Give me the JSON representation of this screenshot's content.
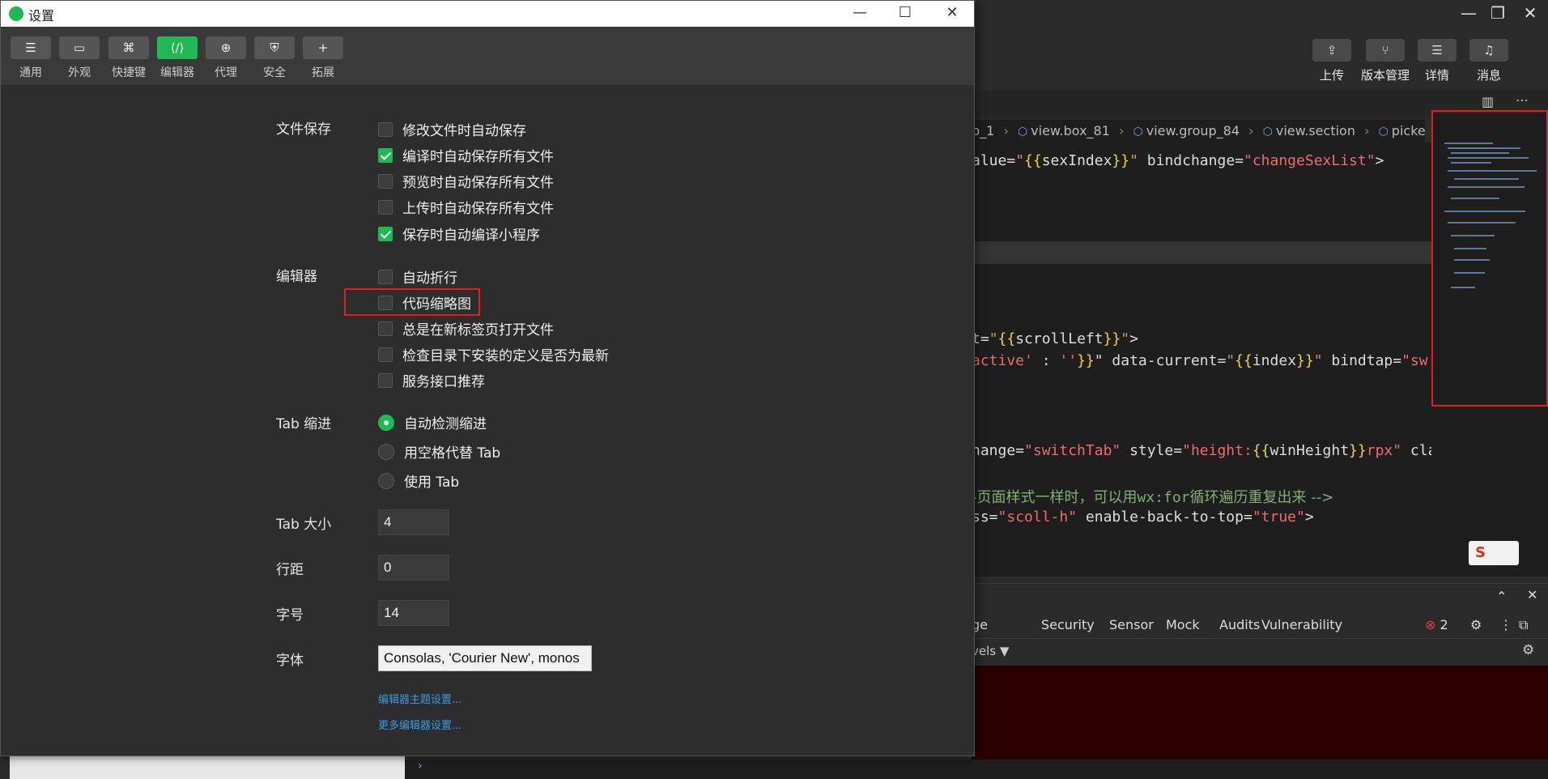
{
  "ide": {
    "toolbar": [
      {
        "icon": "upload-icon",
        "label": "上传"
      },
      {
        "icon": "branch-icon",
        "label": "版本管理"
      },
      {
        "icon": "list-icon",
        "label": "详情"
      },
      {
        "icon": "bell-icon",
        "label": "消息"
      }
    ],
    "breadcrumb": [
      "p_1",
      "view.box_81",
      "view.group_84",
      "view.section",
      "picker"
    ],
    "devtools_tabs": [
      "ge",
      "Security",
      "Sensor",
      "Mock",
      "Audits",
      "Vulnerability"
    ],
    "error_count": "2",
    "filter_label": "vels ▼"
  },
  "dialog": {
    "title": "设置",
    "tabs": [
      {
        "id": "general",
        "label": "通用",
        "glyph": "☰"
      },
      {
        "id": "appearance",
        "label": "外观",
        "glyph": "▭"
      },
      {
        "id": "shortcuts",
        "label": "快捷键",
        "glyph": "⌘"
      },
      {
        "id": "editor",
        "label": "编辑器",
        "glyph": "⟨/⟩"
      },
      {
        "id": "proxy",
        "label": "代理",
        "glyph": "⊕"
      },
      {
        "id": "security",
        "label": "安全",
        "glyph": "⛨"
      },
      {
        "id": "extensions",
        "label": "拓展",
        "glyph": "+"
      }
    ],
    "file_save": {
      "label": "文件保存",
      "options": [
        {
          "label": "修改文件时自动保存",
          "checked": false
        },
        {
          "label": "编译时自动保存所有文件",
          "checked": true
        },
        {
          "label": "预览时自动保存所有文件",
          "checked": false
        },
        {
          "label": "上传时自动保存所有文件",
          "checked": false
        },
        {
          "label": "保存时自动编译小程序",
          "checked": true
        }
      ]
    },
    "editor": {
      "label": "编辑器",
      "options": [
        {
          "label": "自动折行",
          "checked": false
        },
        {
          "label": "代码缩略图",
          "checked": false
        },
        {
          "label": "总是在新标签页打开文件",
          "checked": false
        },
        {
          "label": "检查目录下安装的定义是否为最新",
          "checked": false
        },
        {
          "label": "服务接口推荐",
          "checked": false
        }
      ]
    },
    "tab_indent": {
      "label": "Tab 缩进",
      "options": [
        {
          "label": "自动检测缩进",
          "checked": true
        },
        {
          "label": "用空格代替 Tab",
          "checked": false
        },
        {
          "label": "使用 Tab",
          "checked": false
        }
      ]
    },
    "tab_size": {
      "label": "Tab 大小",
      "value": "4"
    },
    "line_spacing": {
      "label": "行距",
      "value": "0"
    },
    "font_size": {
      "label": "字号",
      "value": "14"
    },
    "font_family": {
      "label": "字体",
      "value": "Consolas, 'Courier New', monos"
    },
    "links": {
      "theme": "编辑器主题设置...",
      "more": "更多编辑器设置..."
    }
  }
}
